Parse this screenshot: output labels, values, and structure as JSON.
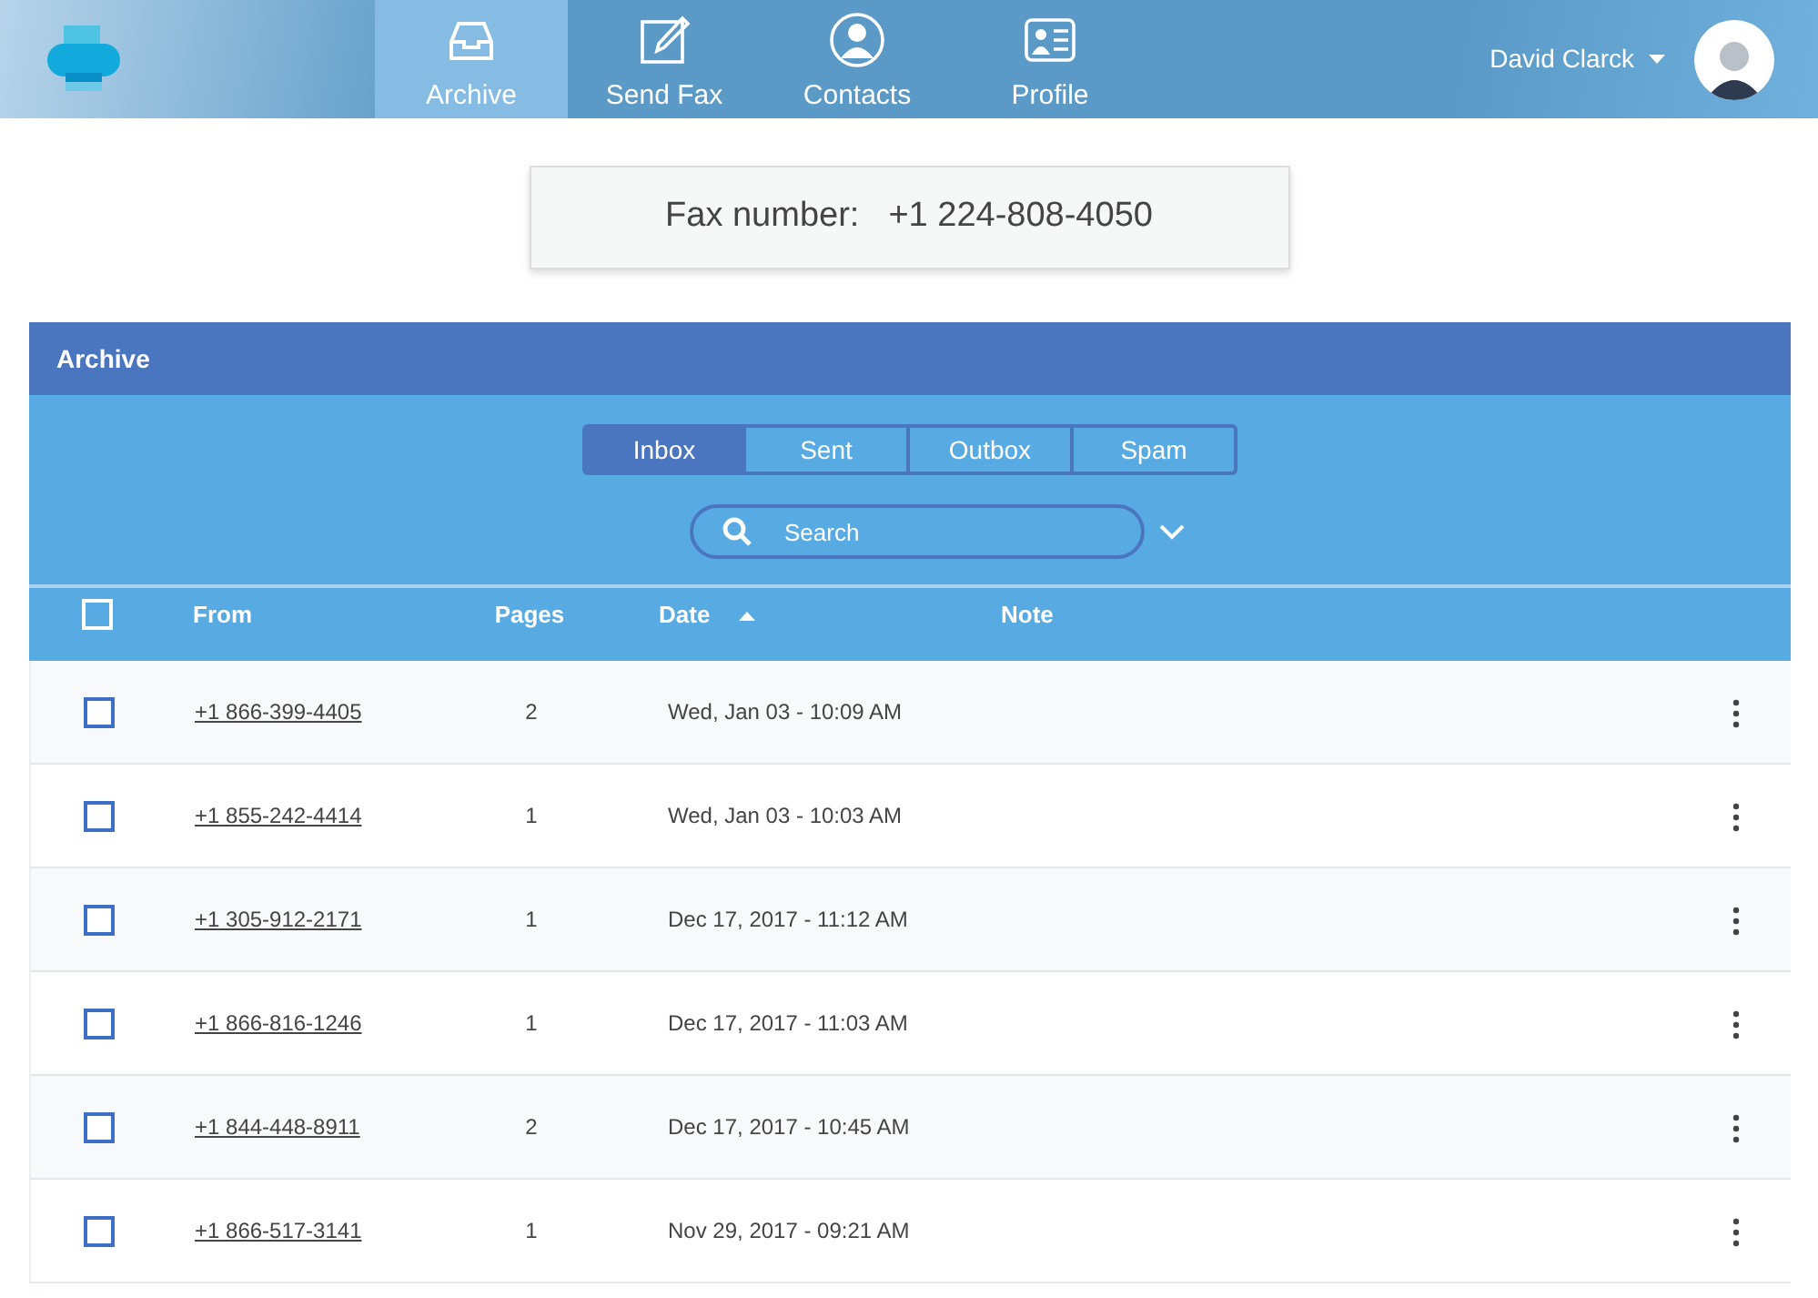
{
  "nav": {
    "items": [
      {
        "label": "Archive",
        "selected": true
      },
      {
        "label": "Send Fax",
        "selected": false
      },
      {
        "label": "Contacts",
        "selected": false
      },
      {
        "label": "Profile",
        "selected": false
      }
    ],
    "user": {
      "name": "David Clarck"
    }
  },
  "fax": {
    "label": "Fax number:",
    "number": "+1 224-808-4050"
  },
  "archive": {
    "title": "Archive",
    "tabs": [
      {
        "label": "Inbox",
        "selected": true
      },
      {
        "label": "Sent",
        "selected": false
      },
      {
        "label": "Outbox",
        "selected": false
      },
      {
        "label": "Spam",
        "selected": false
      }
    ],
    "search": {
      "placeholder": "Search"
    },
    "table": {
      "header_checked": false,
      "columns": [
        {
          "label": "From",
          "sorted": false
        },
        {
          "label": "Pages",
          "sorted": false
        },
        {
          "label": "Date",
          "sorted": true
        },
        {
          "label": "Note",
          "sorted": false
        }
      ],
      "rows": [
        {
          "checked": false,
          "from": "+1 866-399-4405",
          "pages": "2",
          "date": "Wed, Jan 03 - 10:09 AM"
        },
        {
          "checked": false,
          "from": "+1 855-242-4414",
          "pages": "1",
          "date": "Wed, Jan 03 - 10:03 AM"
        },
        {
          "checked": false,
          "from": "+1 305-912-2171",
          "pages": "1",
          "date": "Dec 17, 2017 - 11:12 AM"
        },
        {
          "checked": false,
          "from": "+1 866-816-1246",
          "pages": "1",
          "date": "Dec 17, 2017 - 11:03 AM"
        },
        {
          "checked": false,
          "from": "+1 844-448-8911",
          "pages": "2",
          "date": "Dec 17, 2017 - 10:45 AM"
        },
        {
          "checked": false,
          "from": "+1 866-517-3141",
          "pages": "1",
          "date": "Nov 29, 2017 - 09:21 AM"
        }
      ]
    }
  }
}
